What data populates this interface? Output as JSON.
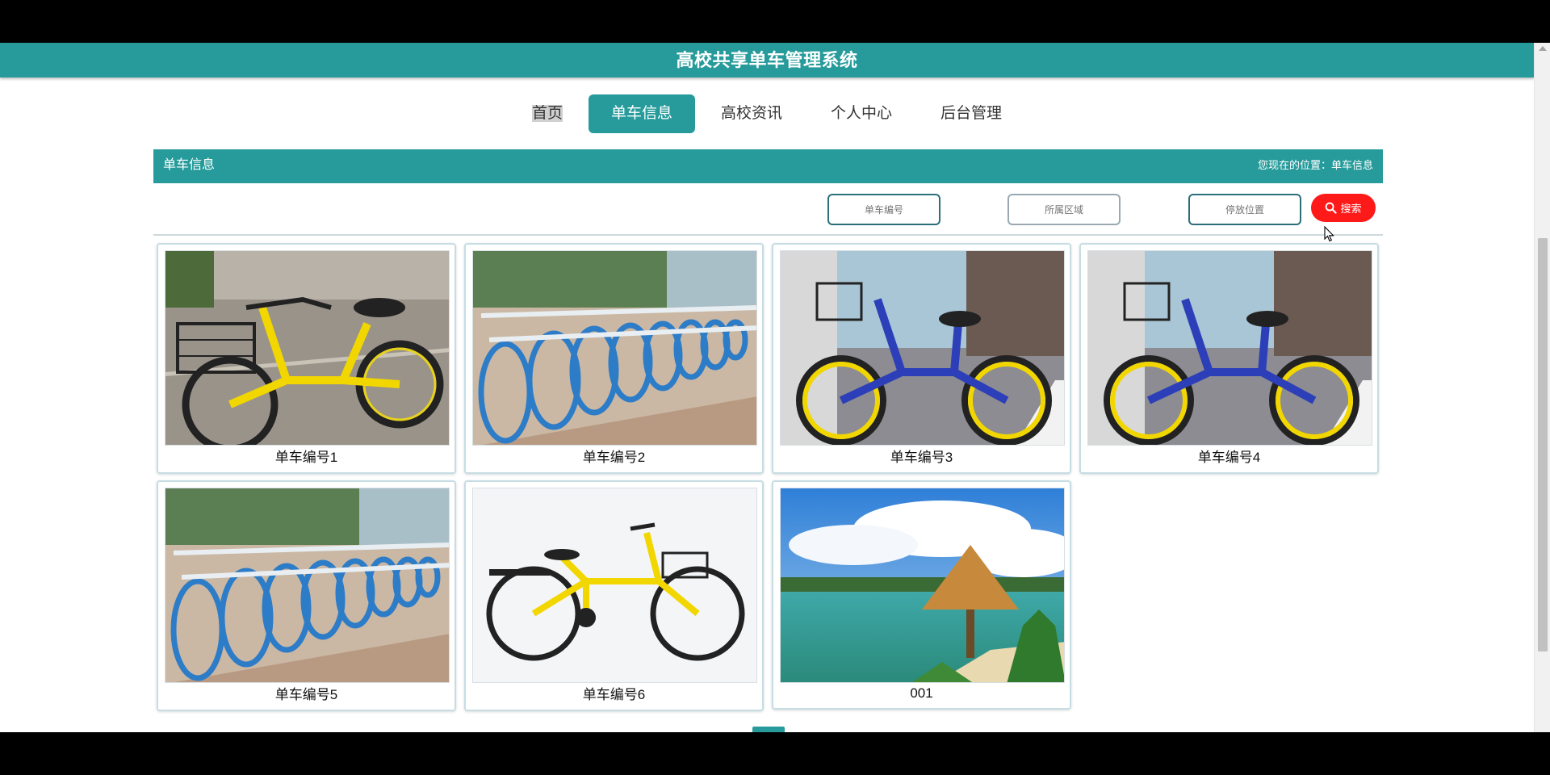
{
  "app": {
    "title": "高校共享单车管理系统"
  },
  "nav": {
    "items": [
      {
        "label": "首页",
        "active": false
      },
      {
        "label": "单车信息",
        "active": true
      },
      {
        "label": "高校资讯",
        "active": false
      },
      {
        "label": "个人中心",
        "active": false
      },
      {
        "label": "后台管理",
        "active": false
      }
    ]
  },
  "section": {
    "title": "单车信息",
    "location_prefix": "您现在的位置：",
    "location_value": "单车信息"
  },
  "search": {
    "bike_number_placeholder": "单车编号",
    "area_placeholder": "所属区域",
    "parking_placeholder": "停放位置",
    "button_label": "搜索"
  },
  "cards": [
    {
      "label": "单车编号1",
      "image": "yellow-bike"
    },
    {
      "label": "单车编号2",
      "image": "blue-bike-row"
    },
    {
      "label": "单车编号3",
      "image": "blue-bike-parked"
    },
    {
      "label": "单车编号4",
      "image": "blue-bike-parked"
    },
    {
      "label": "单车编号5",
      "image": "blue-bike-row"
    },
    {
      "label": "单车编号6",
      "image": "yellow-bike-white-bg"
    },
    {
      "label": "001",
      "image": "tropical-beach"
    }
  ],
  "colors": {
    "primary": "#279b9b",
    "search_button": "#ff1a1a"
  }
}
